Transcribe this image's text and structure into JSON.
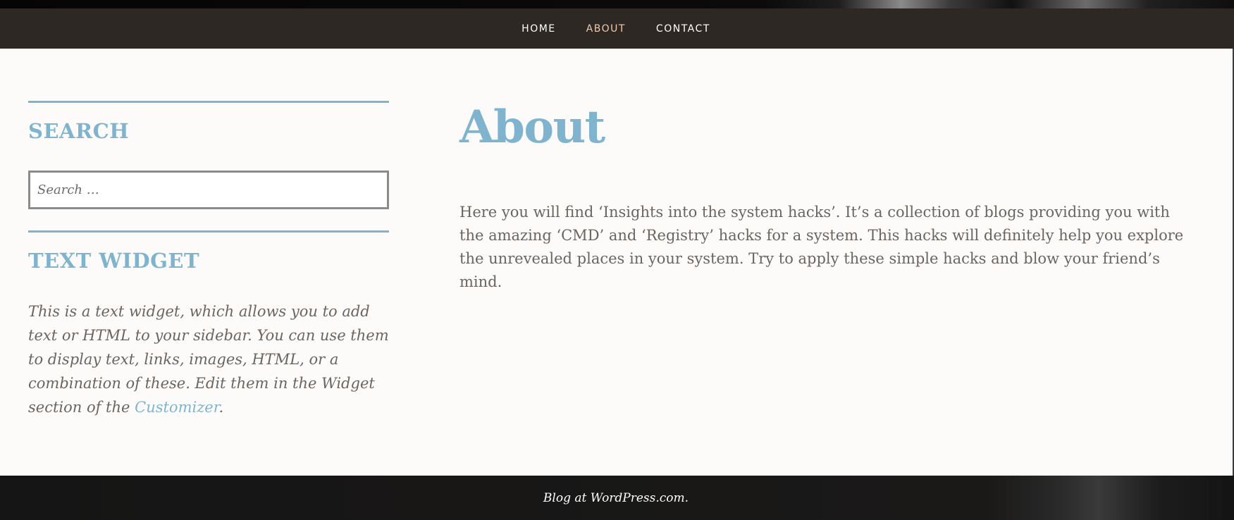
{
  "nav": {
    "items": [
      {
        "label": "HOME",
        "active": false
      },
      {
        "label": "ABOUT",
        "active": true
      },
      {
        "label": "CONTACT",
        "active": false
      }
    ]
  },
  "sidebar": {
    "search": {
      "title": "SEARCH",
      "placeholder": "Search …"
    },
    "text_widget": {
      "title": "TEXT WIDGET",
      "body_before_link": "This is a text widget, which allows you to add text or HTML to your sidebar. You can use them to display text, links, images, HTML, or a combination of these. Edit them in the Widget section of the ",
      "link_label": "Customizer",
      "body_after_link": "."
    }
  },
  "main": {
    "title": "About",
    "body": "Here you will find ‘Insights into the system hacks’. It’s a collection of blogs providing you with the amazing ‘CMD’ and ‘Registry’ hacks for a system. This hacks will definitely help you explore the unrevealed places in your system. Try to apply these simple hacks and blow your friend’s mind."
  },
  "footer": {
    "credit": "Blog at WordPress.com."
  },
  "colors": {
    "accent": "#80b4ce",
    "nav_background": "#2d2824",
    "nav_active": "#f2c8a8",
    "body_text": "#6a6561",
    "footer_background": "#1a1918"
  }
}
